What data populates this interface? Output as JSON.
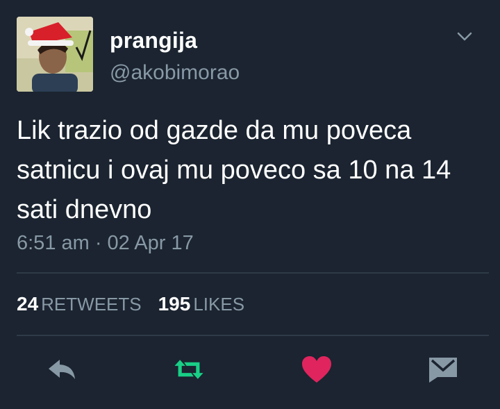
{
  "user": {
    "display_name": "prangija",
    "handle": "@akobimorao"
  },
  "tweet": {
    "text": "Lik trazio od gazde da mu poveca\nsatnicu i ovaj mu poveco sa 10 na 14\nsati dnevno",
    "timestamp": "6:51 am · 02 Apr 17"
  },
  "stats": {
    "retweets_count": "24",
    "retweets_label": "RETWEETS",
    "likes_count": "195",
    "likes_label": "LIKES"
  },
  "actions": {
    "reply_icon": "reply-icon",
    "retweet_icon": "retweet-icon",
    "like_icon": "heart-icon",
    "dm_icon": "envelope-icon"
  },
  "colors": {
    "background": "#1b2430",
    "secondary_text": "#8899a6",
    "retweet_green": "#19cf86",
    "like_red": "#e0245e",
    "icon_gray": "#8899a6"
  }
}
